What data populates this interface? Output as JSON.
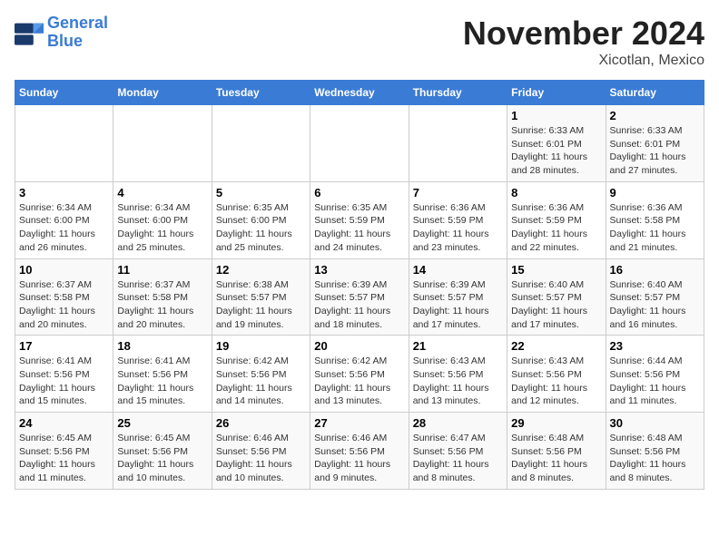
{
  "header": {
    "logo_line1": "General",
    "logo_line2": "Blue",
    "month": "November 2024",
    "location": "Xicotlan, Mexico"
  },
  "weekdays": [
    "Sunday",
    "Monday",
    "Tuesday",
    "Wednesday",
    "Thursday",
    "Friday",
    "Saturday"
  ],
  "weeks": [
    [
      {
        "day": "",
        "info": ""
      },
      {
        "day": "",
        "info": ""
      },
      {
        "day": "",
        "info": ""
      },
      {
        "day": "",
        "info": ""
      },
      {
        "day": "",
        "info": ""
      },
      {
        "day": "1",
        "info": "Sunrise: 6:33 AM\nSunset: 6:01 PM\nDaylight: 11 hours\nand 28 minutes."
      },
      {
        "day": "2",
        "info": "Sunrise: 6:33 AM\nSunset: 6:01 PM\nDaylight: 11 hours\nand 27 minutes."
      }
    ],
    [
      {
        "day": "3",
        "info": "Sunrise: 6:34 AM\nSunset: 6:00 PM\nDaylight: 11 hours\nand 26 minutes."
      },
      {
        "day": "4",
        "info": "Sunrise: 6:34 AM\nSunset: 6:00 PM\nDaylight: 11 hours\nand 25 minutes."
      },
      {
        "day": "5",
        "info": "Sunrise: 6:35 AM\nSunset: 6:00 PM\nDaylight: 11 hours\nand 25 minutes."
      },
      {
        "day": "6",
        "info": "Sunrise: 6:35 AM\nSunset: 5:59 PM\nDaylight: 11 hours\nand 24 minutes."
      },
      {
        "day": "7",
        "info": "Sunrise: 6:36 AM\nSunset: 5:59 PM\nDaylight: 11 hours\nand 23 minutes."
      },
      {
        "day": "8",
        "info": "Sunrise: 6:36 AM\nSunset: 5:59 PM\nDaylight: 11 hours\nand 22 minutes."
      },
      {
        "day": "9",
        "info": "Sunrise: 6:36 AM\nSunset: 5:58 PM\nDaylight: 11 hours\nand 21 minutes."
      }
    ],
    [
      {
        "day": "10",
        "info": "Sunrise: 6:37 AM\nSunset: 5:58 PM\nDaylight: 11 hours\nand 20 minutes."
      },
      {
        "day": "11",
        "info": "Sunrise: 6:37 AM\nSunset: 5:58 PM\nDaylight: 11 hours\nand 20 minutes."
      },
      {
        "day": "12",
        "info": "Sunrise: 6:38 AM\nSunset: 5:57 PM\nDaylight: 11 hours\nand 19 minutes."
      },
      {
        "day": "13",
        "info": "Sunrise: 6:39 AM\nSunset: 5:57 PM\nDaylight: 11 hours\nand 18 minutes."
      },
      {
        "day": "14",
        "info": "Sunrise: 6:39 AM\nSunset: 5:57 PM\nDaylight: 11 hours\nand 17 minutes."
      },
      {
        "day": "15",
        "info": "Sunrise: 6:40 AM\nSunset: 5:57 PM\nDaylight: 11 hours\nand 17 minutes."
      },
      {
        "day": "16",
        "info": "Sunrise: 6:40 AM\nSunset: 5:57 PM\nDaylight: 11 hours\nand 16 minutes."
      }
    ],
    [
      {
        "day": "17",
        "info": "Sunrise: 6:41 AM\nSunset: 5:56 PM\nDaylight: 11 hours\nand 15 minutes."
      },
      {
        "day": "18",
        "info": "Sunrise: 6:41 AM\nSunset: 5:56 PM\nDaylight: 11 hours\nand 15 minutes."
      },
      {
        "day": "19",
        "info": "Sunrise: 6:42 AM\nSunset: 5:56 PM\nDaylight: 11 hours\nand 14 minutes."
      },
      {
        "day": "20",
        "info": "Sunrise: 6:42 AM\nSunset: 5:56 PM\nDaylight: 11 hours\nand 13 minutes."
      },
      {
        "day": "21",
        "info": "Sunrise: 6:43 AM\nSunset: 5:56 PM\nDaylight: 11 hours\nand 13 minutes."
      },
      {
        "day": "22",
        "info": "Sunrise: 6:43 AM\nSunset: 5:56 PM\nDaylight: 11 hours\nand 12 minutes."
      },
      {
        "day": "23",
        "info": "Sunrise: 6:44 AM\nSunset: 5:56 PM\nDaylight: 11 hours\nand 11 minutes."
      }
    ],
    [
      {
        "day": "24",
        "info": "Sunrise: 6:45 AM\nSunset: 5:56 PM\nDaylight: 11 hours\nand 11 minutes."
      },
      {
        "day": "25",
        "info": "Sunrise: 6:45 AM\nSunset: 5:56 PM\nDaylight: 11 hours\nand 10 minutes."
      },
      {
        "day": "26",
        "info": "Sunrise: 6:46 AM\nSunset: 5:56 PM\nDaylight: 11 hours\nand 10 minutes."
      },
      {
        "day": "27",
        "info": "Sunrise: 6:46 AM\nSunset: 5:56 PM\nDaylight: 11 hours\nand 9 minutes."
      },
      {
        "day": "28",
        "info": "Sunrise: 6:47 AM\nSunset: 5:56 PM\nDaylight: 11 hours\nand 8 minutes."
      },
      {
        "day": "29",
        "info": "Sunrise: 6:48 AM\nSunset: 5:56 PM\nDaylight: 11 hours\nand 8 minutes."
      },
      {
        "day": "30",
        "info": "Sunrise: 6:48 AM\nSunset: 5:56 PM\nDaylight: 11 hours\nand 8 minutes."
      }
    ]
  ]
}
